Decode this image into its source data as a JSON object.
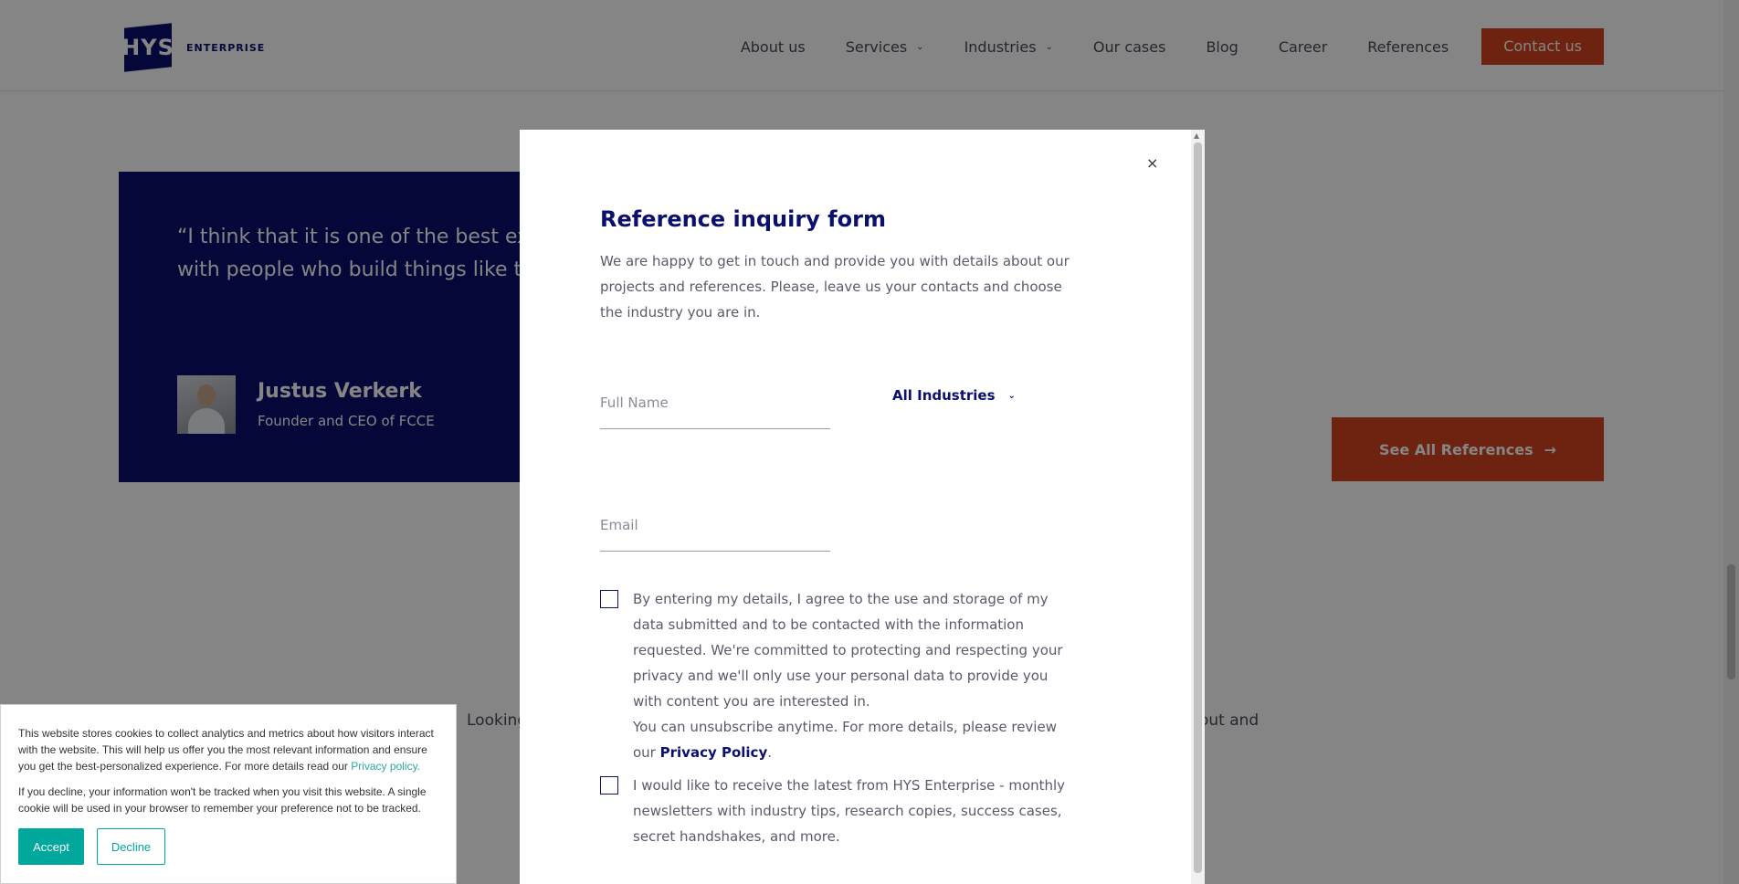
{
  "header": {
    "logo_letters": "HYS",
    "logo_word": "ENTERPRISE",
    "nav": [
      {
        "label": "About us"
      },
      {
        "label": "Services"
      },
      {
        "label": "Industries"
      },
      {
        "label": "Our cases"
      },
      {
        "label": "Blog"
      },
      {
        "label": "Career"
      },
      {
        "label": "References"
      }
    ],
    "cta": "Contact us"
  },
  "testimonial": {
    "quote_line1": "“I think that it is one of the best ex",
    "quote_line2": "with people who build things like t",
    "name": "Justus Verkerk",
    "role": "Founder and CEO of FCCE"
  },
  "see_all_button": "See All References",
  "looking_text_start": "Looking",
  "looking_text_end": "out and",
  "modal": {
    "close": "×",
    "title": "Reference inquiry form",
    "description": "We are happy to get in touch and provide you with details about our projects and references. Please, leave us your contacts and choose the industry you are in.",
    "full_name_placeholder": "Full Name",
    "email_placeholder": "Email",
    "industry_select": "All Industries",
    "consent_text": "By entering my details, I agree to the use and storage of my data submitted and to be contacted with the information requested. We're committed to protecting and respecting your privacy and we'll only use your personal data to provide you with content you are interested in.",
    "unsubscribe_text": "You can unsubscribe anytime. For more details, please review our",
    "privacy_link": "Privacy Policy",
    "period": ".",
    "newsletter_text": "I would like to receive the latest from HYS Enterprise - monthly newsletters with industry tips, research copies, success cases, secret handshakes, and more."
  },
  "cookie": {
    "text1": "This website stores cookies to collect analytics and metrics about how visitors interact with the website. This will help us offer you the most relevant information and ensure you get the best-personalized experience. For more details read our",
    "link": "Privacy policy.",
    "text2": "If you decline, your information won't be tracked when you visit this website. A single cookie will be used in your browser to remember your preference not to be tracked.",
    "accept": "Accept",
    "decline": "Decline"
  },
  "colors": {
    "brand_navy": "#0b0f6e",
    "accent_orange": "#d4421f",
    "cookie_teal": "#00a89c"
  },
  "icons": [
    "chevron-down-icon",
    "close-icon",
    "arrow-right-icon"
  ]
}
